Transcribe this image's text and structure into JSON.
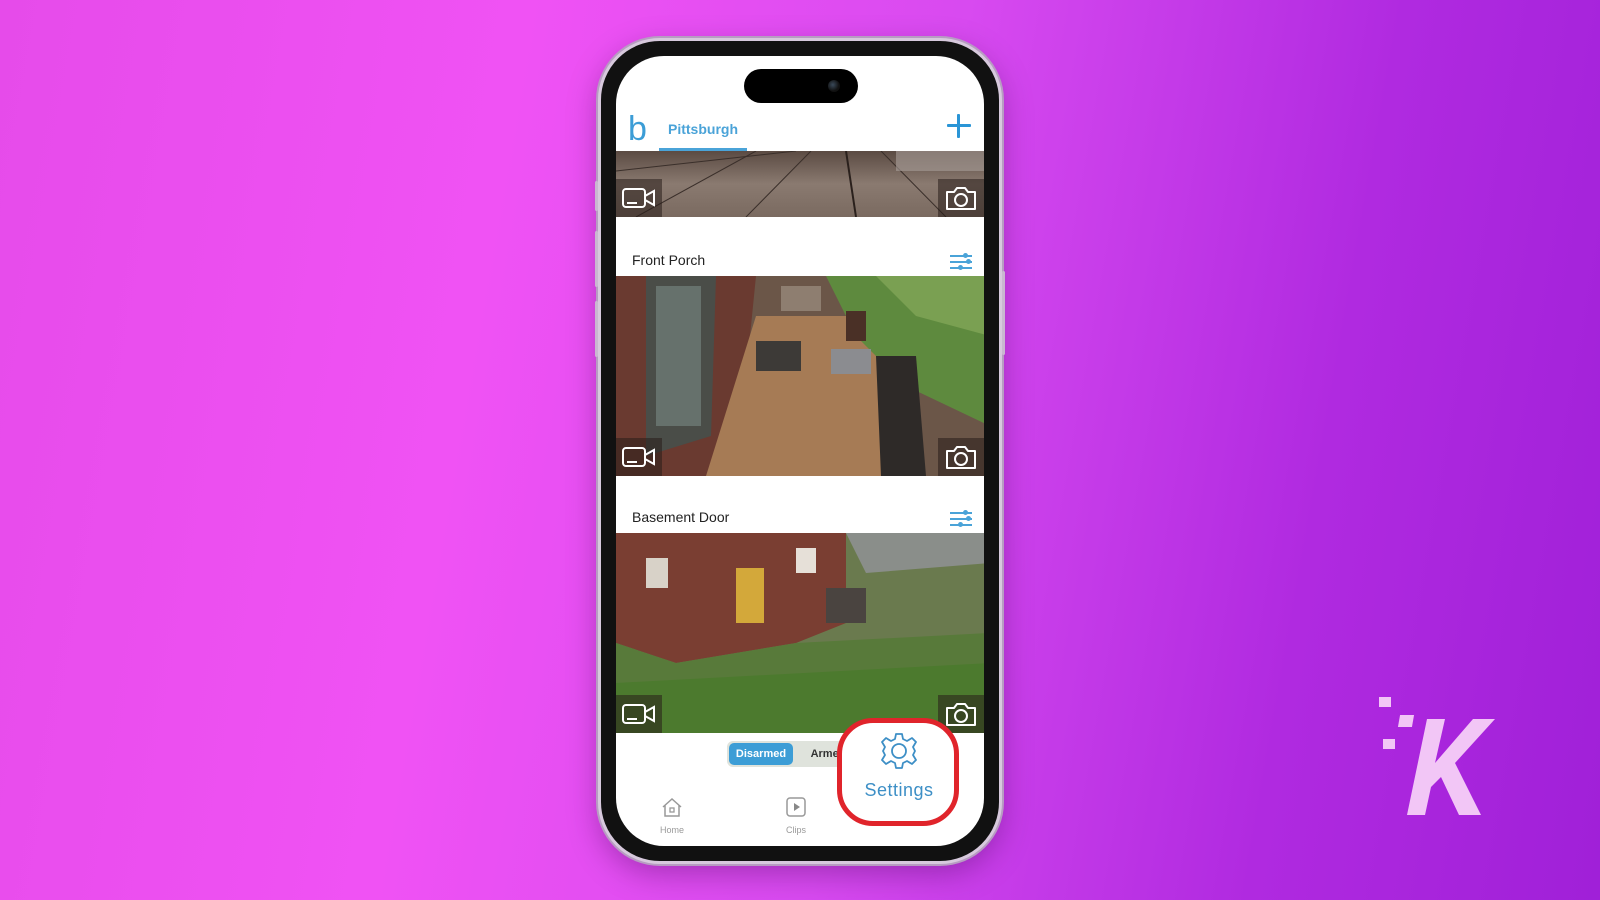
{
  "app": {
    "logo_letter": "b",
    "location_tab": "Pittsburgh",
    "add_button_symbol": "+"
  },
  "cameras": [
    {
      "name": "",
      "icons": [
        "video-clip-icon",
        "snapshot-camera-icon"
      ]
    },
    {
      "name": "Front Porch",
      "settings_icon": "sliders-icon",
      "icons": [
        "video-clip-icon",
        "snapshot-camera-icon"
      ]
    },
    {
      "name": "Basement Door",
      "settings_icon": "sliders-icon",
      "icons": [
        "video-clip-icon",
        "snapshot-camera-icon"
      ]
    }
  ],
  "arm_toggle": {
    "options": [
      "Disarmed",
      "Armed"
    ],
    "selected": "Disarmed"
  },
  "navbar": {
    "items": [
      {
        "label": "Home",
        "icon": "home-icon"
      },
      {
        "label": "Clips",
        "icon": "play-icon"
      },
      {
        "label": "Settings",
        "icon": "gear-icon",
        "highlighted": true
      }
    ]
  },
  "colors": {
    "accent": "#3c9dd6",
    "highlight_ring": "#e0242b",
    "background_start": "#e64bea",
    "background_end": "#a020d8"
  },
  "watermark": {
    "letter": "K"
  }
}
